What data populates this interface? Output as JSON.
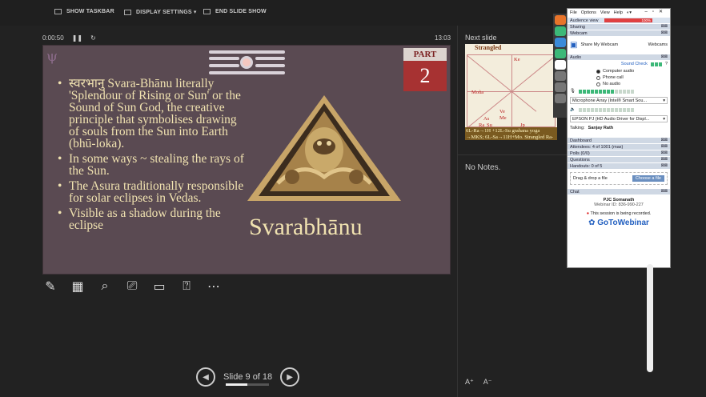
{
  "toolbar": {
    "show_taskbar": "SHOW TASKBAR",
    "display_settings": "DISPLAY SETTINGS ▾",
    "end_slide_show": "END SLIDE SHOW"
  },
  "presenter": {
    "elapsed": "0:00:50",
    "clock": "13:03",
    "next_slide_label": "Next slide",
    "notes": "No Notes.",
    "slide_counter": "Slide 9 of 18",
    "progress_fraction": 0.5
  },
  "slide": {
    "part_label": "PART",
    "part_number": "2",
    "bullets": [
      "स्वरभानु Svara-Bhānu literally 'Splendour of Rising or Sun' or the Sound of Sun God, the creative principle that symbolises drawing of souls from the Sun into Earth (bhū-loka).",
      "In some ways ~ stealing the rays of the Sun.",
      "The Asura traditionally responsible for solar eclipses in Vedas.",
      "Visible as a shadow during the eclipse"
    ],
    "caption": "Svarabhānu"
  },
  "next_slide": {
    "title": "Strangled",
    "chart_labels": [
      "Ke",
      "Moña",
      "Ve",
      "Me",
      "As",
      "Ra",
      "Su",
      "Jp"
    ],
    "footer": "6L-Ra→1H +12L-Su grahana yoga →MKS; 6L-Sa→11H+Mo. Strangled Ra-Mo Utpanna daśā"
  },
  "gotowebinar": {
    "menu": [
      "File",
      "Options",
      "View",
      "Help"
    ],
    "audience_view": "Audience view",
    "audience_pct": "100%",
    "sections": {
      "sharing": "Sharing",
      "webcam": "Webcam",
      "share_webcam": "Share My Webcam",
      "webcams": "Webcams",
      "audio": "Audio",
      "sound_check": "Sound Check",
      "computer_audio": "Computer audio",
      "phone_call": "Phone call",
      "no_audio": "No audio",
      "mic": "Microphone Array (Intel® Smart Sou...",
      "speaker": "EPSON PJ (HD Audio Driver for Displ...",
      "talking_label": "Talking:",
      "talking_name": "Sanjay Rath",
      "dashboard": "Dashboard",
      "attendees": "Attendees: 4 of 1001 (max)",
      "polls": "Polls (0/0)",
      "questions": "Questions",
      "handouts": "Handouts: 0 of 5",
      "drag_drop": "Drag & drop a file",
      "choose_file": "Choose a file",
      "chat": "Chat",
      "organizer": "PJC Somanath",
      "webinar_id": "Webinar ID: 836-990-227",
      "recording": "This session is being recorded.",
      "brand": "GoToWebinar"
    }
  },
  "colors": {
    "slide_bg": "#5a4a52",
    "slide_text": "#f0e2b0",
    "part_red": "#a73232",
    "gtw_blue": "#2360c0"
  }
}
